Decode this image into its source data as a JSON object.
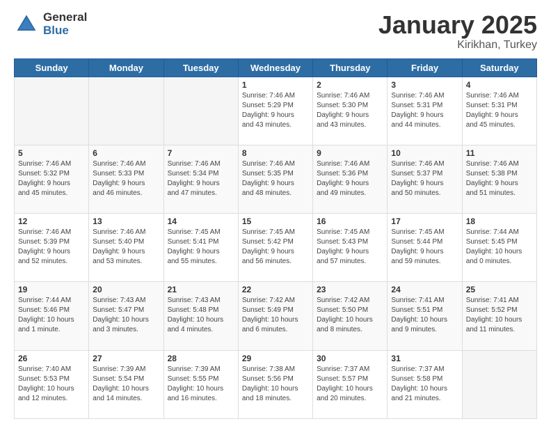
{
  "logo": {
    "general": "General",
    "blue": "Blue"
  },
  "title": {
    "month": "January 2025",
    "location": "Kirikhan, Turkey"
  },
  "weekdays": [
    "Sunday",
    "Monday",
    "Tuesday",
    "Wednesday",
    "Thursday",
    "Friday",
    "Saturday"
  ],
  "weeks": [
    [
      {
        "day": "",
        "info": ""
      },
      {
        "day": "",
        "info": ""
      },
      {
        "day": "",
        "info": ""
      },
      {
        "day": "1",
        "info": "Sunrise: 7:46 AM\nSunset: 5:29 PM\nDaylight: 9 hours\nand 43 minutes."
      },
      {
        "day": "2",
        "info": "Sunrise: 7:46 AM\nSunset: 5:30 PM\nDaylight: 9 hours\nand 43 minutes."
      },
      {
        "day": "3",
        "info": "Sunrise: 7:46 AM\nSunset: 5:31 PM\nDaylight: 9 hours\nand 44 minutes."
      },
      {
        "day": "4",
        "info": "Sunrise: 7:46 AM\nSunset: 5:31 PM\nDaylight: 9 hours\nand 45 minutes."
      }
    ],
    [
      {
        "day": "5",
        "info": "Sunrise: 7:46 AM\nSunset: 5:32 PM\nDaylight: 9 hours\nand 45 minutes."
      },
      {
        "day": "6",
        "info": "Sunrise: 7:46 AM\nSunset: 5:33 PM\nDaylight: 9 hours\nand 46 minutes."
      },
      {
        "day": "7",
        "info": "Sunrise: 7:46 AM\nSunset: 5:34 PM\nDaylight: 9 hours\nand 47 minutes."
      },
      {
        "day": "8",
        "info": "Sunrise: 7:46 AM\nSunset: 5:35 PM\nDaylight: 9 hours\nand 48 minutes."
      },
      {
        "day": "9",
        "info": "Sunrise: 7:46 AM\nSunset: 5:36 PM\nDaylight: 9 hours\nand 49 minutes."
      },
      {
        "day": "10",
        "info": "Sunrise: 7:46 AM\nSunset: 5:37 PM\nDaylight: 9 hours\nand 50 minutes."
      },
      {
        "day": "11",
        "info": "Sunrise: 7:46 AM\nSunset: 5:38 PM\nDaylight: 9 hours\nand 51 minutes."
      }
    ],
    [
      {
        "day": "12",
        "info": "Sunrise: 7:46 AM\nSunset: 5:39 PM\nDaylight: 9 hours\nand 52 minutes."
      },
      {
        "day": "13",
        "info": "Sunrise: 7:46 AM\nSunset: 5:40 PM\nDaylight: 9 hours\nand 53 minutes."
      },
      {
        "day": "14",
        "info": "Sunrise: 7:45 AM\nSunset: 5:41 PM\nDaylight: 9 hours\nand 55 minutes."
      },
      {
        "day": "15",
        "info": "Sunrise: 7:45 AM\nSunset: 5:42 PM\nDaylight: 9 hours\nand 56 minutes."
      },
      {
        "day": "16",
        "info": "Sunrise: 7:45 AM\nSunset: 5:43 PM\nDaylight: 9 hours\nand 57 minutes."
      },
      {
        "day": "17",
        "info": "Sunrise: 7:45 AM\nSunset: 5:44 PM\nDaylight: 9 hours\nand 59 minutes."
      },
      {
        "day": "18",
        "info": "Sunrise: 7:44 AM\nSunset: 5:45 PM\nDaylight: 10 hours\nand 0 minutes."
      }
    ],
    [
      {
        "day": "19",
        "info": "Sunrise: 7:44 AM\nSunset: 5:46 PM\nDaylight: 10 hours\nand 1 minute."
      },
      {
        "day": "20",
        "info": "Sunrise: 7:43 AM\nSunset: 5:47 PM\nDaylight: 10 hours\nand 3 minutes."
      },
      {
        "day": "21",
        "info": "Sunrise: 7:43 AM\nSunset: 5:48 PM\nDaylight: 10 hours\nand 4 minutes."
      },
      {
        "day": "22",
        "info": "Sunrise: 7:42 AM\nSunset: 5:49 PM\nDaylight: 10 hours\nand 6 minutes."
      },
      {
        "day": "23",
        "info": "Sunrise: 7:42 AM\nSunset: 5:50 PM\nDaylight: 10 hours\nand 8 minutes."
      },
      {
        "day": "24",
        "info": "Sunrise: 7:41 AM\nSunset: 5:51 PM\nDaylight: 10 hours\nand 9 minutes."
      },
      {
        "day": "25",
        "info": "Sunrise: 7:41 AM\nSunset: 5:52 PM\nDaylight: 10 hours\nand 11 minutes."
      }
    ],
    [
      {
        "day": "26",
        "info": "Sunrise: 7:40 AM\nSunset: 5:53 PM\nDaylight: 10 hours\nand 12 minutes."
      },
      {
        "day": "27",
        "info": "Sunrise: 7:39 AM\nSunset: 5:54 PM\nDaylight: 10 hours\nand 14 minutes."
      },
      {
        "day": "28",
        "info": "Sunrise: 7:39 AM\nSunset: 5:55 PM\nDaylight: 10 hours\nand 16 minutes."
      },
      {
        "day": "29",
        "info": "Sunrise: 7:38 AM\nSunset: 5:56 PM\nDaylight: 10 hours\nand 18 minutes."
      },
      {
        "day": "30",
        "info": "Sunrise: 7:37 AM\nSunset: 5:57 PM\nDaylight: 10 hours\nand 20 minutes."
      },
      {
        "day": "31",
        "info": "Sunrise: 7:37 AM\nSunset: 5:58 PM\nDaylight: 10 hours\nand 21 minutes."
      },
      {
        "day": "",
        "info": ""
      }
    ]
  ]
}
